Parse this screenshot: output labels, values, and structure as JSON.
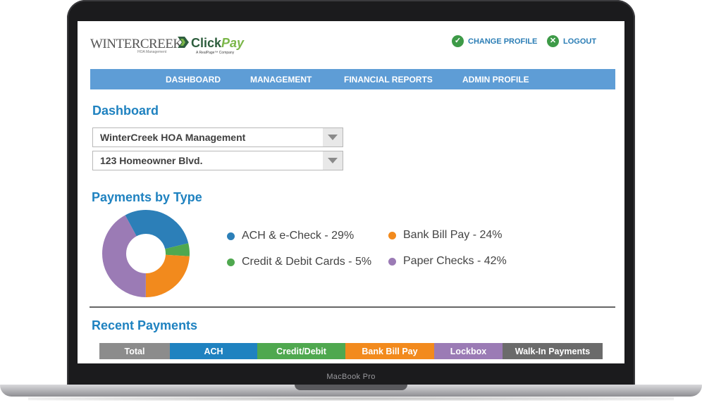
{
  "header": {
    "brand_primary": "WINTERCREEK",
    "brand_primary_sub": "HOA Management",
    "brand_secondary_a": "Click",
    "brand_secondary_b": "Pay",
    "brand_secondary_sub": "A RealPage™ Company",
    "change_profile_label": "CHANGE PROFILE",
    "logout_label": "LOGOUT"
  },
  "nav": {
    "items": [
      {
        "label": "DASHBOARD"
      },
      {
        "label": "MANAGEMENT"
      },
      {
        "label": "FINANCIAL REPORTS"
      },
      {
        "label": "ADMIN PROFILE"
      }
    ]
  },
  "page_title": "Dashboard",
  "selects": {
    "company": "WinterCreek HOA Management",
    "address": "123 Homeowner Blvd."
  },
  "payments_by_type": {
    "title": "Payments by Type",
    "legend": [
      {
        "label": "ACH & e-Check - 29%",
        "color": "#2c7fb8"
      },
      {
        "label": "Bank Bill Pay - 24%",
        "color": "#f28a1d"
      },
      {
        "label": "Credit & Debit Cards - 5%",
        "color": "#4fa84f"
      },
      {
        "label": "Paper Checks - 42%",
        "color": "#9b7bb5"
      }
    ]
  },
  "chart_data": {
    "type": "pie",
    "categories": [
      "ACH & e-Check",
      "Bank Bill Pay",
      "Credit & Debit Cards",
      "Paper Checks"
    ],
    "values": [
      29,
      24,
      5,
      42
    ],
    "title": "Payments by Type"
  },
  "recent_payments": {
    "title": "Recent Payments",
    "tabs": [
      {
        "label": "Total",
        "color": "#8c8c8c"
      },
      {
        "label": "ACH",
        "color": "#1f82c0"
      },
      {
        "label": "Credit/Debit",
        "color": "#4fa84f"
      },
      {
        "label": "Bank Bill Pay",
        "color": "#f28a1d"
      },
      {
        "label": "Lockbox",
        "color": "#9b7bb5"
      },
      {
        "label": "Walk-In Payments",
        "color": "#6b6b6b"
      }
    ]
  },
  "device_label": "MacBook Pro"
}
